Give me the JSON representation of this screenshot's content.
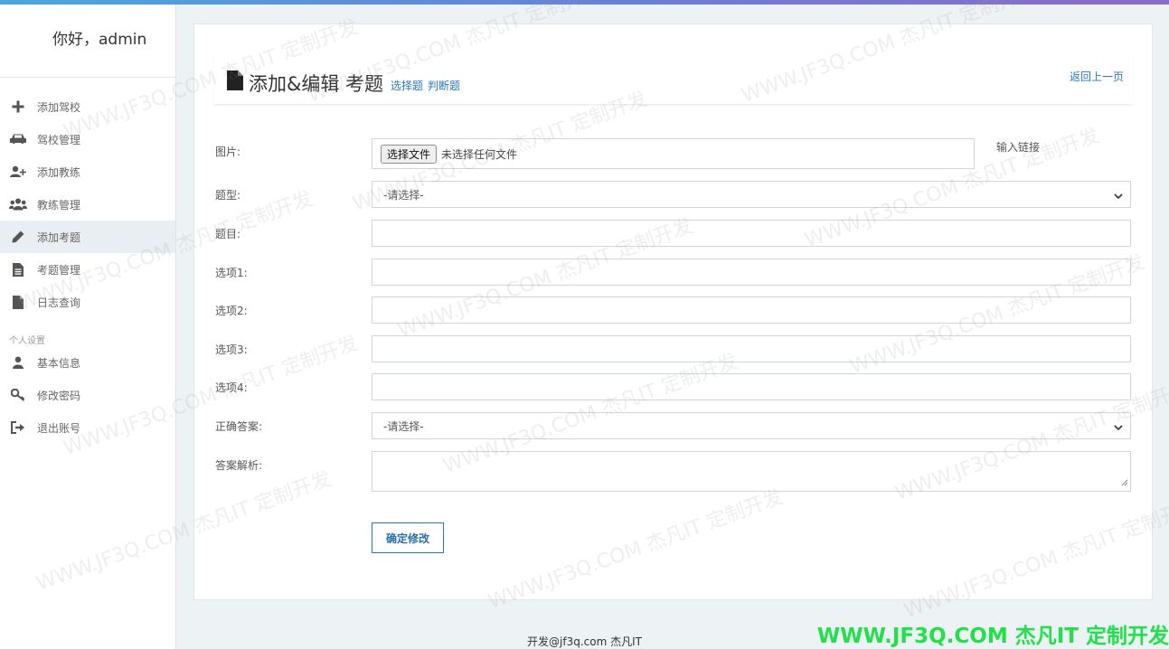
{
  "sidebar": {
    "greeting": "你好，admin",
    "section_personal": "个人设置",
    "items": [
      {
        "label": "添加驾校",
        "icon": "plus-icon"
      },
      {
        "label": "驾校管理",
        "icon": "car-icon"
      },
      {
        "label": "添加教练",
        "icon": "user-add-icon"
      },
      {
        "label": "教练管理",
        "icon": "users-icon"
      },
      {
        "label": "添加考题",
        "icon": "pencil-icon",
        "active": true
      },
      {
        "label": "考题管理",
        "icon": "file-text-icon"
      },
      {
        "label": "日志查询",
        "icon": "file-icon"
      },
      {
        "label": "基本信息",
        "icon": "user-icon"
      },
      {
        "label": "修改密码",
        "icon": "key-icon"
      },
      {
        "label": "退出账号",
        "icon": "sign-out-icon"
      }
    ]
  },
  "header": {
    "title": "添加&编辑 考题",
    "link_choice": "选择题",
    "link_judge": "判断题",
    "back": "返回上一页"
  },
  "form": {
    "image_label": "图片:",
    "file_button": "选择文件",
    "file_status": "未选择任何文件",
    "link_input": "输入链接",
    "type_label": "题型:",
    "type_value": "-请选择-",
    "question_label": "题目:",
    "option1_label": "选项1:",
    "option2_label": "选项2:",
    "option3_label": "选项3:",
    "option4_label": "选项4:",
    "answer_label": "正确答案:",
    "answer_value": "-请选择-",
    "analysis_label": "答案解析:",
    "submit": "确定修改"
  },
  "footer": {
    "text": "开发@jf3q.com 杰凡IT"
  },
  "watermark": {
    "corner": "WWW.JF3Q.COM 杰凡IT  定制开发",
    "text": "WWW.JF3Q.COM 杰凡IT  定制开发"
  },
  "colors": {
    "accent": "#2a7ab8",
    "watermark_green": "#22e04a",
    "sidebar_active": "#e9eef2"
  }
}
